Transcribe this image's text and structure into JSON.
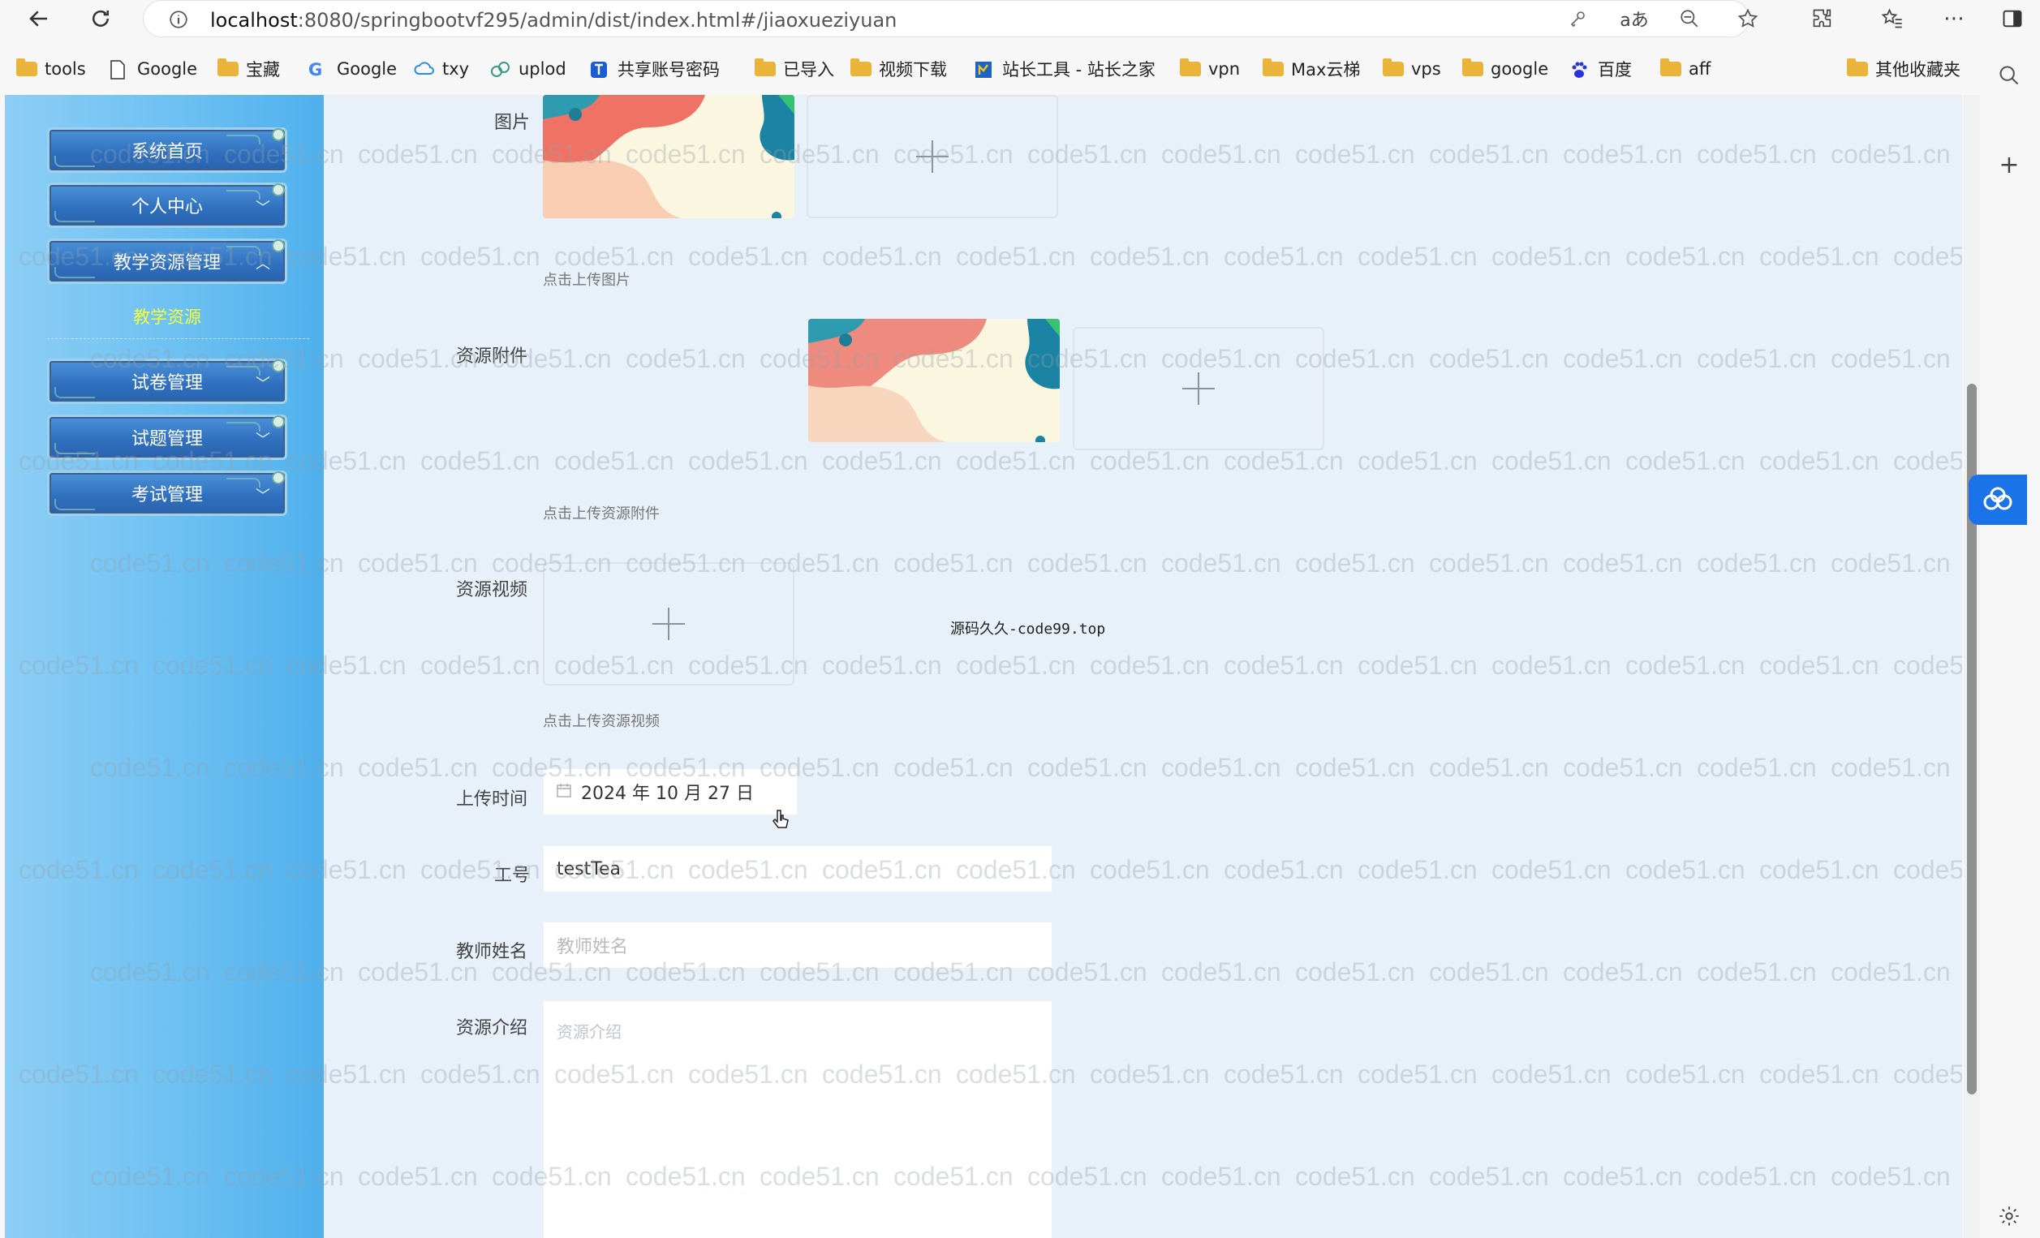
{
  "browser": {
    "url_host": "localhost",
    "url_rest": ":8080/springbootvf295/admin/dist/index.html#/jiaoxueziyuan",
    "bookmarks": [
      "tools",
      "Google",
      "宝藏",
      "Google",
      "txy",
      "uplod",
      "共享账号密码",
      "已导入",
      "视频下载",
      "站长工具 - 站长之家",
      "vpn",
      "Max云梯",
      "vps",
      "google",
      "百度",
      "aff"
    ],
    "other_bookmarks": "其他收藏夹"
  },
  "sidebar": {
    "items": [
      {
        "label": "系统首页"
      },
      {
        "label": "个人中心",
        "arrow": "﹀"
      },
      {
        "label": "教学资源管理",
        "arrow": "︿"
      },
      {
        "label": "试卷管理",
        "arrow": "﹀"
      },
      {
        "label": "试题管理",
        "arrow": "﹀"
      },
      {
        "label": "考试管理",
        "arrow": "﹀"
      }
    ],
    "sub_item": "教学资源"
  },
  "form": {
    "image_label": "图片",
    "image_hint": "点击上传图片",
    "attachment_label": "资源附件",
    "attachment_hint": "点击上传资源附件",
    "video_label": "资源视频",
    "video_hint": "点击上传资源视频",
    "upload_time_label": "上传时间",
    "upload_time_value": "2024 年 10 月 27 日",
    "employee_id_label": "工号",
    "employee_id_value": "testTea",
    "teacher_name_label": "教师姓名",
    "teacher_name_placeholder": "教师姓名",
    "intro_label": "资源介绍",
    "intro_placeholder": "资源介绍"
  },
  "overlay_text": "源码久久-code99.top",
  "watermark": "code51.cn",
  "colors": {
    "sidebar": "#6cc0f2",
    "content_bg": "#e8f0f9",
    "menu_button": "#2f6fbe",
    "active_sub": "#f4ff3a"
  }
}
